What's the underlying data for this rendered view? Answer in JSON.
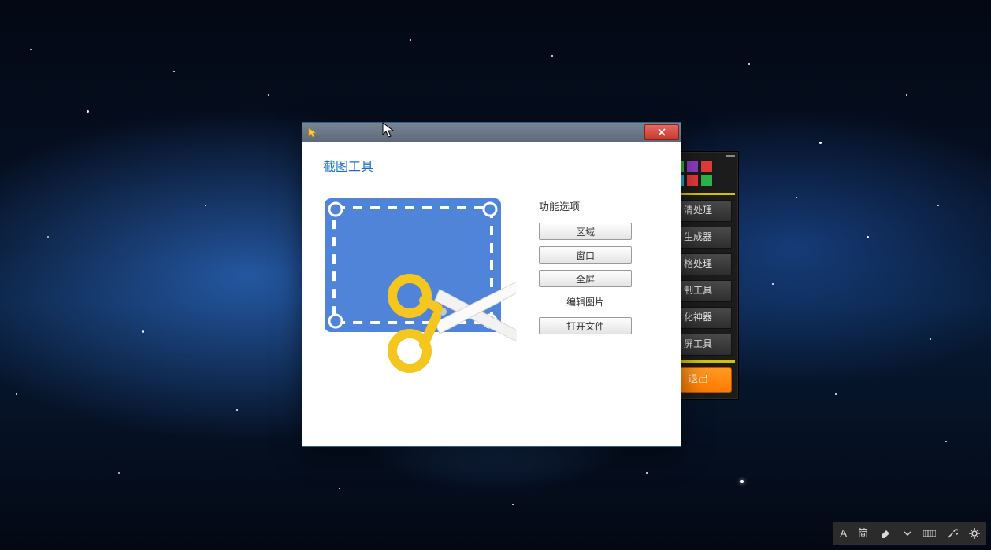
{
  "window": {
    "title": "截图工具",
    "options_heading": "功能选项",
    "buttons": {
      "region": "区域",
      "window": "窗口",
      "fullscreen": "全屏",
      "edit_image": "编辑图片",
      "open_file": "打开文件"
    }
  },
  "back_panel": {
    "colors": [
      "#2bb44a",
      "#8c3cc0",
      "#e03a3a",
      "#1fa8d8",
      "#e03a3a",
      "#2bb44a"
    ],
    "tools": [
      "清处理",
      "生成器",
      "格处理",
      "制工具",
      "化神器",
      "屏工具"
    ],
    "exit": "退出"
  },
  "ime": {
    "letter": "A",
    "mode": "简"
  }
}
